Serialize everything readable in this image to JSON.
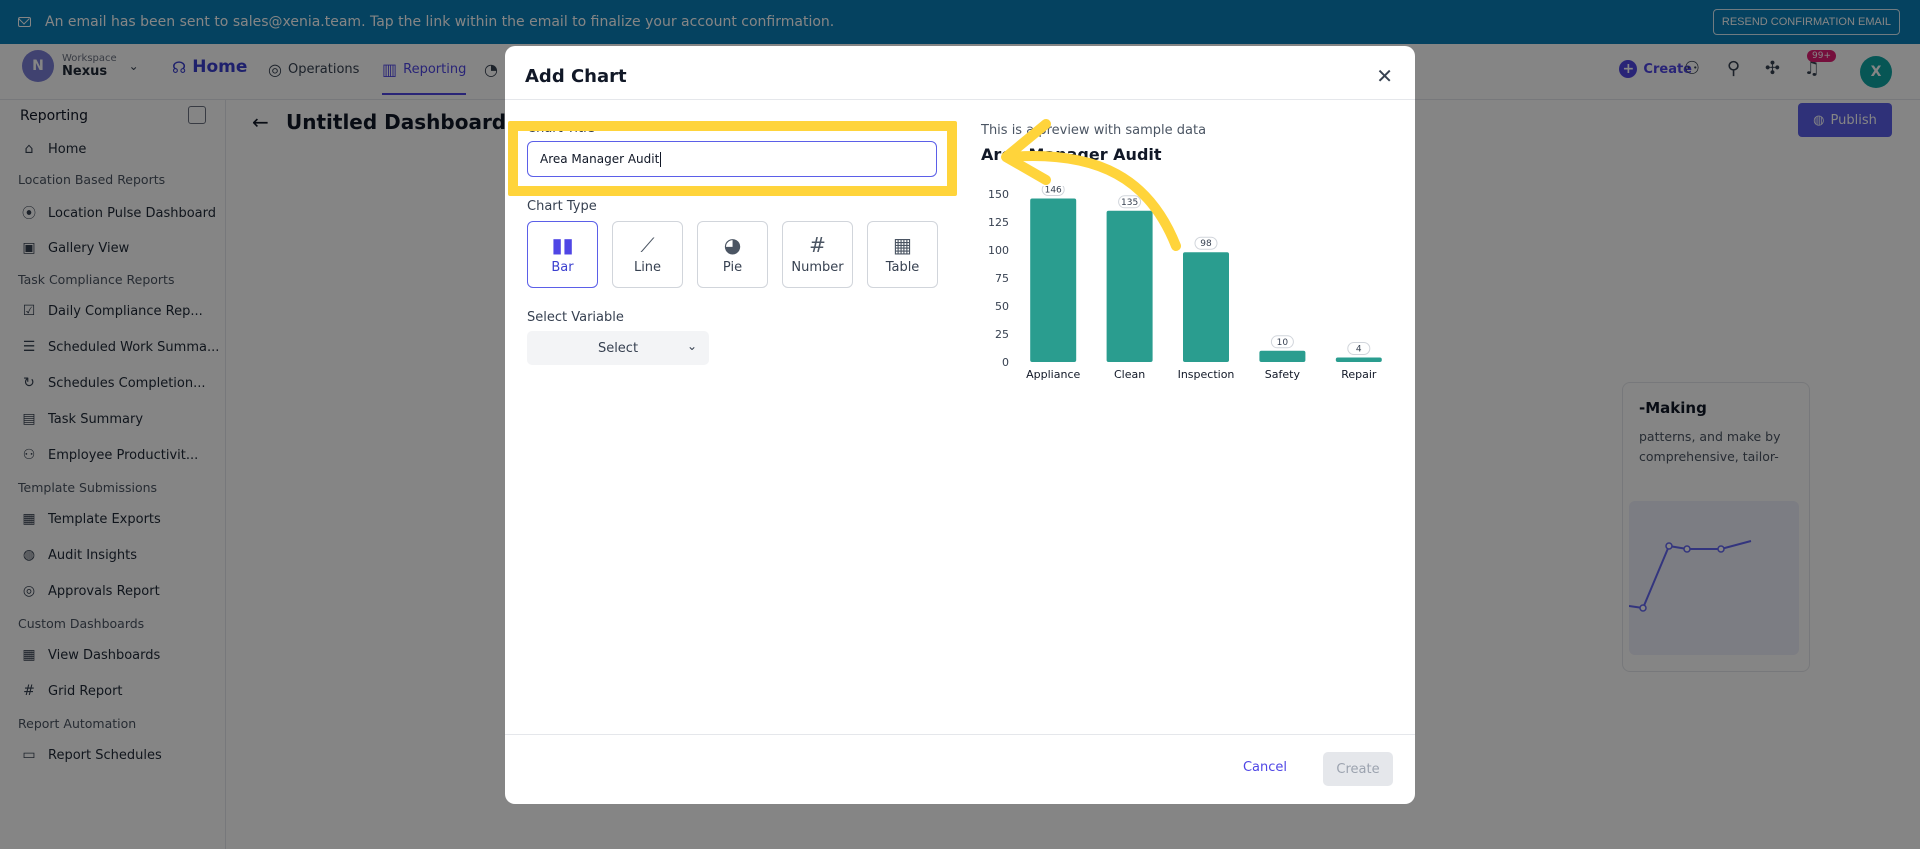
{
  "banner": {
    "message": "An email has been sent to sales@xenia.team. Tap the link within the email to finalize your account confirmation.",
    "resend_label": "RESEND CONFIRMATION EMAIL"
  },
  "nav": {
    "workspace_label": "Workspace",
    "workspace_name": "Nexus",
    "workspace_initial": "N",
    "home": "Home",
    "operations": "Operations",
    "reporting": "Reporting",
    "create": "Create",
    "notifications_badge": "99+",
    "user_initial": "X"
  },
  "sidebar": {
    "title": "Reporting",
    "home": "Home",
    "sections": {
      "location": "Location Based Reports",
      "task": "Task Compliance Reports",
      "template": "Template Submissions",
      "custom": "Custom Dashboards",
      "automation": "Report Automation"
    },
    "items": {
      "location_pulse": "Location Pulse Dashboard",
      "gallery": "Gallery View",
      "daily_compliance": "Daily Compliance Rep...",
      "scheduled_work": "Scheduled Work Summa...",
      "schedules_completion": "Schedules Completion...",
      "task_summary": "Task Summary",
      "employee_productivity": "Employee Productivit...",
      "template_exports": "Template Exports",
      "audit_insights": "Audit Insights",
      "approvals": "Approvals Report",
      "view_dashboards": "View Dashboards",
      "grid_report": "Grid Report",
      "report_schedules": "Report Schedules"
    }
  },
  "main": {
    "title": "Untitled Dashboard",
    "publish": "Publish",
    "card_title": "-Making",
    "card_desc": "patterns, and make by comprehensive, tailor-"
  },
  "modal": {
    "title": "Add Chart",
    "chart_title_label": "Chart Title",
    "chart_title_value": "Area Manager Audit",
    "chart_type_label": "Chart Type",
    "types": [
      "Bar",
      "Line",
      "Pie",
      "Number",
      "Table"
    ],
    "select_variable_label": "Select Variable",
    "select_placeholder": "Select",
    "preview_note": "This is a preview with sample data",
    "preview_title": "Area Manager Audit",
    "cancel": "Cancel",
    "create": "Create"
  },
  "chart_data": {
    "type": "bar",
    "title": "Area Manager Audit",
    "categories": [
      "Appliance",
      "Clean",
      "Inspection",
      "Safety",
      "Repair"
    ],
    "values": [
      146,
      135,
      98,
      10,
      4
    ],
    "ylim": [
      0,
      150
    ],
    "yticks": [
      0,
      25,
      50,
      75,
      100,
      125,
      150
    ],
    "bar_color": "#2a9d8f"
  },
  "colors": {
    "accent": "#4f46e5",
    "banner": "#0b7fb8",
    "highlight": "#ffd43b"
  }
}
